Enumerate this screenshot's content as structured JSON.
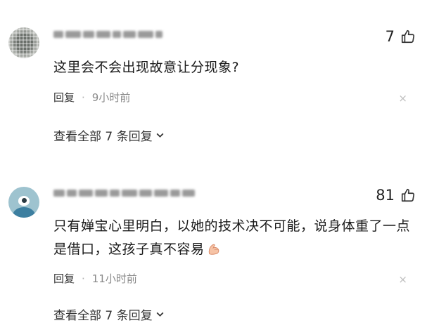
{
  "comments": [
    {
      "likes": "7",
      "text": "这里会不会出现故意让分现象?",
      "reply_label": "回复",
      "separator": "·",
      "time": "9小时前",
      "close": "×",
      "view_replies": "查看全部 7 条回复"
    },
    {
      "likes": "81",
      "text": "只有婵宝心里明白，以她的技术决不可能，说身体重了一点是借口，这孩子真不容易",
      "reply_label": "回复",
      "separator": "·",
      "time": "11小时前",
      "close": "×",
      "view_replies": "查看全部 7 条回复"
    }
  ],
  "icons": {
    "like": "thumbs-up-icon",
    "chevron": "chevron-down-icon",
    "emoji": "flexed-biceps-icon",
    "close": "close-icon"
  }
}
